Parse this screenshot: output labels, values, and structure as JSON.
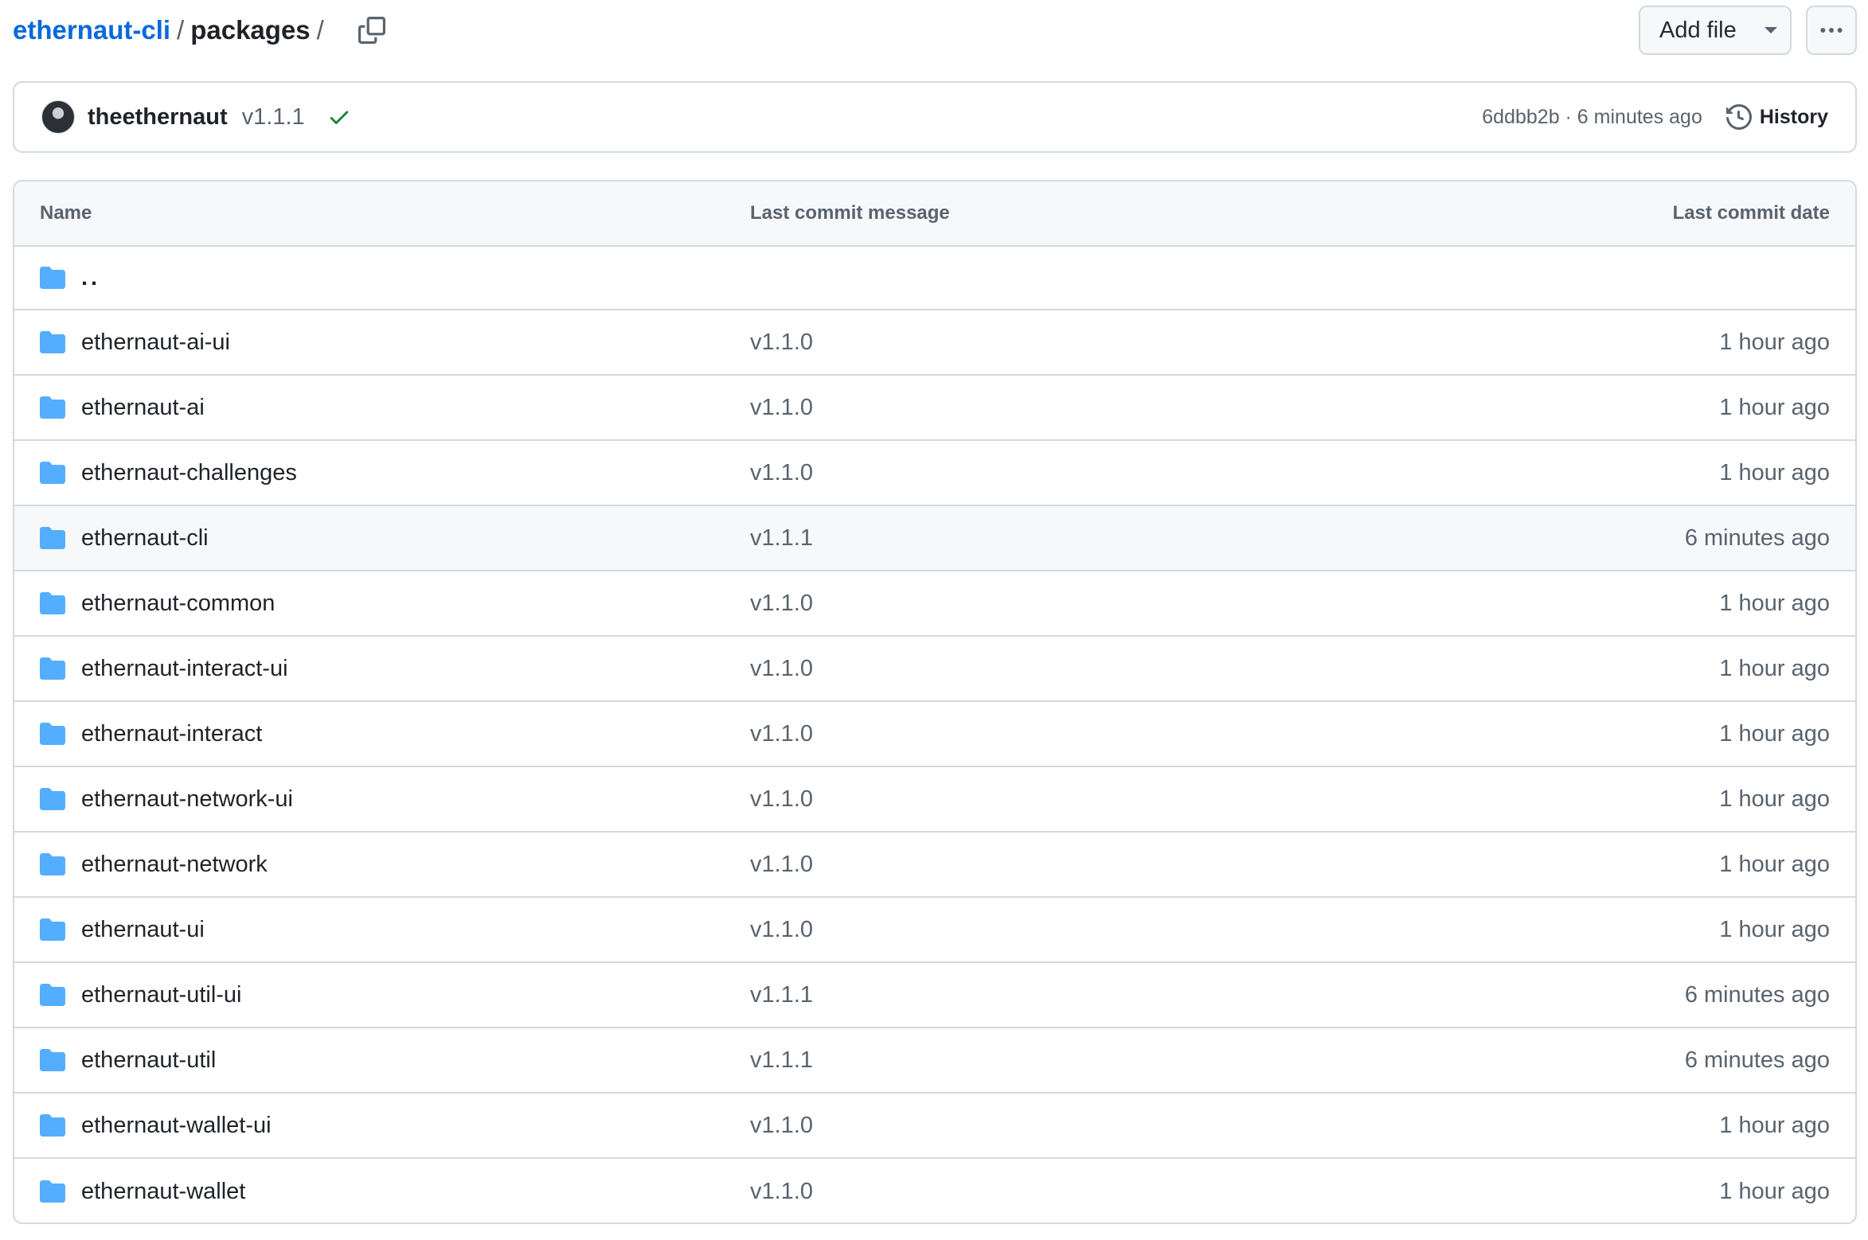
{
  "breadcrumb": {
    "repo": "ethernaut-cli",
    "separator": "/",
    "current": "packages",
    "trailing_separator": "/",
    "copy_icon": "copy-icon"
  },
  "actions": {
    "add_file_label": "Add file",
    "more_icon": "kebab-horizontal-icon"
  },
  "latest_commit": {
    "author": "theethernaut",
    "message": "v1.1.1",
    "status_icon": "check-icon",
    "status_color": "#1a7f37",
    "meta": "6ddbb2b · 6 minutes ago",
    "history_label": "History",
    "history_icon": "history-icon"
  },
  "table": {
    "headers": {
      "name": "Name",
      "message": "Last commit message",
      "date": "Last commit date"
    },
    "parent_label": "..",
    "folder_color": "#54aeff",
    "rows": [
      {
        "name": "ethernaut-ai-ui",
        "message": "v1.1.0",
        "date": "1 hour ago"
      },
      {
        "name": "ethernaut-ai",
        "message": "v1.1.0",
        "date": "1 hour ago"
      },
      {
        "name": "ethernaut-challenges",
        "message": "v1.1.0",
        "date": "1 hour ago"
      },
      {
        "name": "ethernaut-cli",
        "message": "v1.1.1",
        "date": "6 minutes ago"
      },
      {
        "name": "ethernaut-common",
        "message": "v1.1.0",
        "date": "1 hour ago"
      },
      {
        "name": "ethernaut-interact-ui",
        "message": "v1.1.0",
        "date": "1 hour ago"
      },
      {
        "name": "ethernaut-interact",
        "message": "v1.1.0",
        "date": "1 hour ago"
      },
      {
        "name": "ethernaut-network-ui",
        "message": "v1.1.0",
        "date": "1 hour ago"
      },
      {
        "name": "ethernaut-network",
        "message": "v1.1.0",
        "date": "1 hour ago"
      },
      {
        "name": "ethernaut-ui",
        "message": "v1.1.0",
        "date": "1 hour ago"
      },
      {
        "name": "ethernaut-util-ui",
        "message": "v1.1.1",
        "date": "6 minutes ago"
      },
      {
        "name": "ethernaut-util",
        "message": "v1.1.1",
        "date": "6 minutes ago"
      },
      {
        "name": "ethernaut-wallet-ui",
        "message": "v1.1.0",
        "date": "1 hour ago"
      },
      {
        "name": "ethernaut-wallet",
        "message": "v1.1.0",
        "date": "1 hour ago"
      }
    ]
  }
}
